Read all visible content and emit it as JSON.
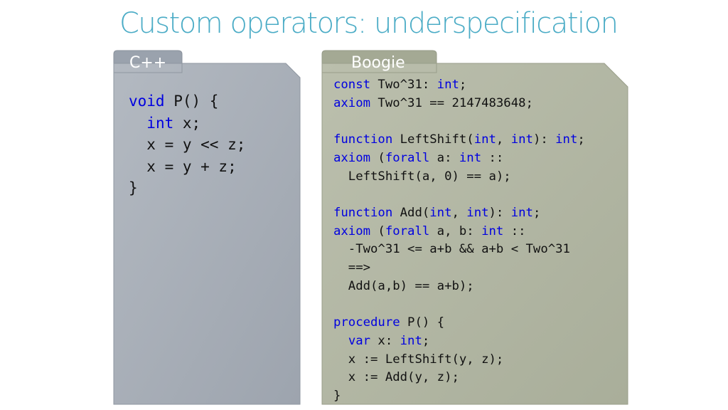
{
  "title": "Custom operators: underspecification",
  "colors": {
    "title": "#4bacc6",
    "keyword": "#0000e0",
    "cpp_panel": "#a9b0b9",
    "boogie_panel": "#b2b7a4"
  },
  "cpp": {
    "tab_label": "C++",
    "lines": [
      [
        {
          "t": "void",
          "k": true
        },
        {
          "t": " P() {",
          "k": false
        }
      ],
      [
        {
          "t": "  ",
          "k": false
        },
        {
          "t": "int",
          "k": true
        },
        {
          "t": " x;",
          "k": false
        }
      ],
      [
        {
          "t": "  x = y << z;",
          "k": false
        }
      ],
      [
        {
          "t": "  x = y + z;",
          "k": false
        }
      ],
      [
        {
          "t": "}",
          "k": false
        }
      ]
    ]
  },
  "boogie": {
    "tab_label": "Boogie",
    "lines": [
      [
        {
          "t": "const",
          "k": true
        },
        {
          "t": " Two^31: ",
          "k": false
        },
        {
          "t": "int",
          "k": true
        },
        {
          "t": ";",
          "k": false
        }
      ],
      [
        {
          "t": "axiom",
          "k": true
        },
        {
          "t": " Two^31 == 2147483648;",
          "k": false
        }
      ],
      [
        {
          "t": "",
          "k": false
        }
      ],
      [
        {
          "t": "function",
          "k": true
        },
        {
          "t": " LeftShift(",
          "k": false
        },
        {
          "t": "int",
          "k": true
        },
        {
          "t": ", ",
          "k": false
        },
        {
          "t": "int",
          "k": true
        },
        {
          "t": "): ",
          "k": false
        },
        {
          "t": "int",
          "k": true
        },
        {
          "t": ";",
          "k": false
        }
      ],
      [
        {
          "t": "axiom",
          "k": true
        },
        {
          "t": " (",
          "k": false
        },
        {
          "t": "forall",
          "k": true
        },
        {
          "t": " a: ",
          "k": false
        },
        {
          "t": "int",
          "k": true
        },
        {
          "t": " ::",
          "k": false
        }
      ],
      [
        {
          "t": "  LeftShift(a, 0) == a);",
          "k": false
        }
      ],
      [
        {
          "t": "",
          "k": false
        }
      ],
      [
        {
          "t": "function",
          "k": true
        },
        {
          "t": " Add(",
          "k": false
        },
        {
          "t": "int",
          "k": true
        },
        {
          "t": ", ",
          "k": false
        },
        {
          "t": "int",
          "k": true
        },
        {
          "t": "): ",
          "k": false
        },
        {
          "t": "int",
          "k": true
        },
        {
          "t": ";",
          "k": false
        }
      ],
      [
        {
          "t": "axiom",
          "k": true
        },
        {
          "t": " (",
          "k": false
        },
        {
          "t": "forall",
          "k": true
        },
        {
          "t": " a, b: ",
          "k": false
        },
        {
          "t": "int",
          "k": true
        },
        {
          "t": " ::",
          "k": false
        }
      ],
      [
        {
          "t": "  -Two^31 <= a+b && a+b < Two^31",
          "k": false
        }
      ],
      [
        {
          "t": "  ==>",
          "k": false
        }
      ],
      [
        {
          "t": "  Add(a,b) == a+b);",
          "k": false
        }
      ],
      [
        {
          "t": "",
          "k": false
        }
      ],
      [
        {
          "t": "procedure",
          "k": true
        },
        {
          "t": " P() {",
          "k": false
        }
      ],
      [
        {
          "t": "  ",
          "k": false
        },
        {
          "t": "var",
          "k": true
        },
        {
          "t": " x: ",
          "k": false
        },
        {
          "t": "int",
          "k": true
        },
        {
          "t": ";",
          "k": false
        }
      ],
      [
        {
          "t": "  x := LeftShift(y, z);",
          "k": false
        }
      ],
      [
        {
          "t": "  x := Add(y, z);",
          "k": false
        }
      ],
      [
        {
          "t": "}",
          "k": false
        }
      ]
    ]
  }
}
